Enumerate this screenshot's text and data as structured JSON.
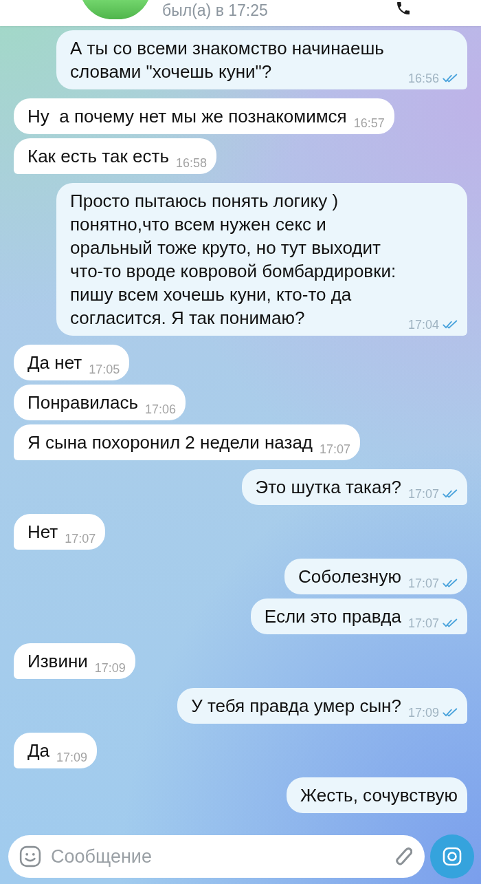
{
  "header": {
    "status": "был(а) в 17:25"
  },
  "messages": [
    {
      "kind": "outgoing",
      "text": "А ты со всеми знакомство начинаешь словами \"хочешь куни\"?",
      "time": "16:56",
      "read": true
    },
    {
      "kind": "incoming",
      "text": "Ну  а почему нет мы же познакомимся",
      "time": "16:57"
    },
    {
      "kind": "incoming",
      "text": "Как есть так есть",
      "time": "16:58"
    },
    {
      "kind": "outgoing",
      "text": "Просто пытаюсь понять логику ) понятно,что всем нужен секс и\nоральный тоже круто, но тут выходит что-то вроде ковровой бомбардировки: пишу всем хочешь куни, кто-то да согласится. Я так понимаю?",
      "time": "17:04",
      "read": true
    },
    {
      "kind": "incoming",
      "text": "Да нет",
      "time": "17:05"
    },
    {
      "kind": "incoming",
      "text": "Понравилась",
      "time": "17:06"
    },
    {
      "kind": "incoming",
      "text": "Я сына похоронил 2 недели назад",
      "time": "17:07"
    },
    {
      "kind": "outgoing",
      "text": "Это шутка такая?",
      "time": "17:07",
      "read": true
    },
    {
      "kind": "incoming",
      "text": "Нет",
      "time": "17:07"
    },
    {
      "kind": "outgoing",
      "text": "Соболезную",
      "time": "17:07",
      "read": true
    },
    {
      "kind": "outgoing",
      "text": "Если это правда",
      "time": "17:07",
      "read": true
    },
    {
      "kind": "incoming",
      "text": "Извини",
      "time": "17:09"
    },
    {
      "kind": "outgoing",
      "text": "У тебя правда умер сын?",
      "time": "17:09",
      "read": true
    },
    {
      "kind": "incoming",
      "text": "Да",
      "time": "17:09"
    },
    {
      "kind": "outgoing",
      "text": "Жесть, сочувствую"
    }
  ],
  "composer": {
    "placeholder": "Сообщение"
  }
}
